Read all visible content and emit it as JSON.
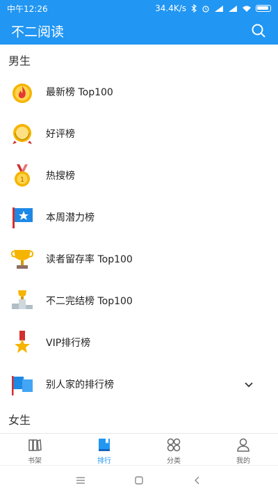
{
  "status": {
    "time": "中午12:26",
    "speed": "34.4K/s"
  },
  "app": {
    "title": "不二阅读"
  },
  "male": {
    "header": "男生",
    "items": [
      {
        "label": "最新榜 Top100",
        "icon": "fire-medal-icon"
      },
      {
        "label": "好评榜",
        "icon": "laurel-medal-icon"
      },
      {
        "label": "热搜榜",
        "icon": "gold-medal-icon"
      },
      {
        "label": "本周潜力榜",
        "icon": "star-flag-icon"
      },
      {
        "label": "读者留存率 Top100",
        "icon": "trophy-cup-icon"
      },
      {
        "label": "不二完结榜 Top100",
        "icon": "podium-trophy-icon"
      },
      {
        "label": "VIP排行榜",
        "icon": "star-ribbon-medal-icon"
      },
      {
        "label": "别人家的排行榜",
        "icon": "blue-flags-icon"
      }
    ]
  },
  "female": {
    "header": "女生"
  },
  "tabs": [
    {
      "label": "书架",
      "icon": "bookshelf-icon"
    },
    {
      "label": "排行",
      "icon": "ranking-book-icon"
    },
    {
      "label": "分类",
      "icon": "category-grid-icon"
    },
    {
      "label": "我的",
      "icon": "profile-icon"
    }
  ],
  "colors": {
    "primary": "#2196f3",
    "medal_gold": "#f5b400",
    "flag_blue": "#1e88e5",
    "ribbon_red": "#d32f2f"
  }
}
